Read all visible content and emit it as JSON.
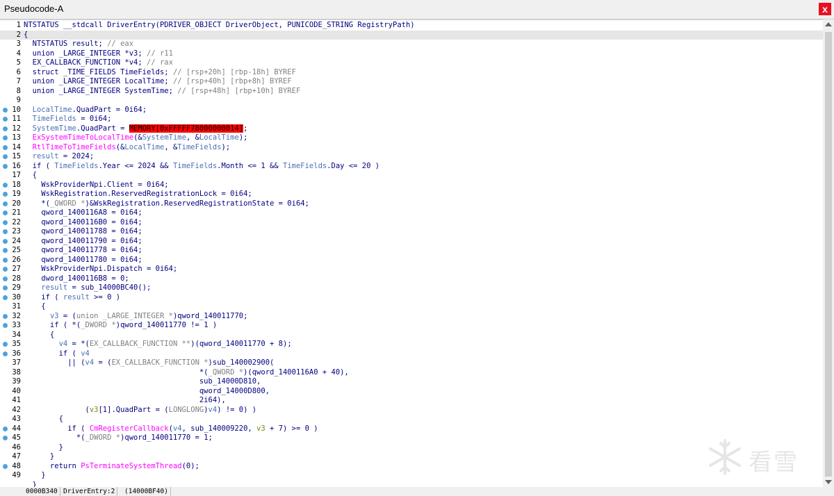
{
  "tab": {
    "title": "Pseudocode-A",
    "close_glyph": "x"
  },
  "colors": {
    "background": "#ffffff",
    "current_line": "#e6e6e6",
    "highlight": "#ff0000",
    "breakpoint": "#4aa3df"
  },
  "code_lines": [
    {
      "n": "1",
      "dot": false,
      "current": false,
      "parts": [
        [
          "k",
          "NTSTATUS __stdcall DriverEntry(PDRIVER_OBJECT DriverObject, PUNICODE_STRING RegistryPath)"
        ]
      ]
    },
    {
      "n": "2",
      "dot": false,
      "current": true,
      "parts": [
        [
          "k",
          "{"
        ]
      ]
    },
    {
      "n": "3",
      "dot": false,
      "current": false,
      "parts": [
        [
          "k",
          "  NTSTATUS result; "
        ],
        [
          "g",
          "// eax"
        ]
      ]
    },
    {
      "n": "4",
      "dot": false,
      "current": false,
      "parts": [
        [
          "k",
          "  union _LARGE_INTEGER *v3; "
        ],
        [
          "g",
          "// r11"
        ]
      ]
    },
    {
      "n": "5",
      "dot": false,
      "current": false,
      "parts": [
        [
          "k",
          "  EX_CALLBACK_FUNCTION *v4; "
        ],
        [
          "g",
          "// rax"
        ]
      ]
    },
    {
      "n": "6",
      "dot": false,
      "current": false,
      "parts": [
        [
          "k",
          "  struct _TIME_FIELDS TimeFields; "
        ],
        [
          "g",
          "// [rsp+20h] [rbp-18h] BYREF"
        ]
      ]
    },
    {
      "n": "7",
      "dot": false,
      "current": false,
      "parts": [
        [
          "k",
          "  union _LARGE_INTEGER LocalTime; "
        ],
        [
          "g",
          "// [rsp+40h] [rbp+8h] BYREF"
        ]
      ]
    },
    {
      "n": "8",
      "dot": false,
      "current": false,
      "parts": [
        [
          "k",
          "  union _LARGE_INTEGER SystemTime; "
        ],
        [
          "g",
          "// [rsp+48h] [rbp+10h] BYREF"
        ]
      ]
    },
    {
      "n": "9",
      "dot": false,
      "current": false,
      "parts": [
        [
          "k",
          ""
        ]
      ]
    },
    {
      "n": "10",
      "dot": true,
      "current": false,
      "parts": [
        [
          "k",
          "  "
        ],
        [
          "v",
          "LocalTime"
        ],
        [
          "k",
          ".QuadPart = 0i64;"
        ]
      ]
    },
    {
      "n": "11",
      "dot": true,
      "current": false,
      "parts": [
        [
          "k",
          "  "
        ],
        [
          "v",
          "TimeFields"
        ],
        [
          "k",
          " = 0i64;"
        ]
      ]
    },
    {
      "n": "12",
      "dot": true,
      "current": false,
      "parts": [
        [
          "k",
          "  "
        ],
        [
          "v",
          "SystemTime"
        ],
        [
          "k",
          ".QuadPart = "
        ],
        [
          "h",
          "MEMORY[0xFFFFF78000000014]"
        ],
        [
          "k",
          ";"
        ]
      ]
    },
    {
      "n": "13",
      "dot": true,
      "current": false,
      "parts": [
        [
          "k",
          "  "
        ],
        [
          "p",
          "ExSystemTimeToLocalTime"
        ],
        [
          "k",
          "(&"
        ],
        [
          "v",
          "SystemTime"
        ],
        [
          "k",
          ", &"
        ],
        [
          "v",
          "LocalTime"
        ],
        [
          "k",
          ");"
        ]
      ]
    },
    {
      "n": "14",
      "dot": true,
      "current": false,
      "parts": [
        [
          "k",
          "  "
        ],
        [
          "p",
          "RtlTimeToTimeFields"
        ],
        [
          "k",
          "(&"
        ],
        [
          "v",
          "LocalTime"
        ],
        [
          "k",
          ", &"
        ],
        [
          "v",
          "TimeFields"
        ],
        [
          "k",
          ");"
        ]
      ]
    },
    {
      "n": "15",
      "dot": true,
      "current": false,
      "parts": [
        [
          "k",
          "  "
        ],
        [
          "v",
          "result"
        ],
        [
          "k",
          " = 2024;"
        ]
      ]
    },
    {
      "n": "16",
      "dot": true,
      "current": false,
      "parts": [
        [
          "k",
          "  if ( "
        ],
        [
          "v",
          "TimeFields"
        ],
        [
          "k",
          ".Year <= 2024 && "
        ],
        [
          "v",
          "TimeFields"
        ],
        [
          "k",
          ".Month <= 1 && "
        ],
        [
          "v",
          "TimeFields"
        ],
        [
          "k",
          ".Day <= 20 )"
        ]
      ]
    },
    {
      "n": "17",
      "dot": false,
      "current": false,
      "parts": [
        [
          "k",
          "  {"
        ]
      ]
    },
    {
      "n": "18",
      "dot": true,
      "current": false,
      "parts": [
        [
          "k",
          "    WskProviderNpi.Client = 0i64;"
        ]
      ]
    },
    {
      "n": "19",
      "dot": true,
      "current": false,
      "parts": [
        [
          "k",
          "    WskRegistration.ReservedRegistrationLock = 0i64;"
        ]
      ]
    },
    {
      "n": "20",
      "dot": true,
      "current": false,
      "parts": [
        [
          "k",
          "    *("
        ],
        [
          "g",
          "_QWORD *"
        ],
        [
          "k",
          ")&WskRegistration.ReservedRegistrationState = 0i64;"
        ]
      ]
    },
    {
      "n": "21",
      "dot": true,
      "current": false,
      "parts": [
        [
          "k",
          "    qword_1400116A8 = 0i64;"
        ]
      ]
    },
    {
      "n": "22",
      "dot": true,
      "current": false,
      "parts": [
        [
          "k",
          "    qword_1400116B0 = 0i64;"
        ]
      ]
    },
    {
      "n": "23",
      "dot": true,
      "current": false,
      "parts": [
        [
          "k",
          "    qword_140011788 = 0i64;"
        ]
      ]
    },
    {
      "n": "24",
      "dot": true,
      "current": false,
      "parts": [
        [
          "k",
          "    qword_140011790 = 0i64;"
        ]
      ]
    },
    {
      "n": "25",
      "dot": true,
      "current": false,
      "parts": [
        [
          "k",
          "    qword_140011778 = 0i64;"
        ]
      ]
    },
    {
      "n": "26",
      "dot": true,
      "current": false,
      "parts": [
        [
          "k",
          "    qword_140011780 = 0i64;"
        ]
      ]
    },
    {
      "n": "27",
      "dot": true,
      "current": false,
      "parts": [
        [
          "k",
          "    WskProviderNpi.Dispatch = 0i64;"
        ]
      ]
    },
    {
      "n": "28",
      "dot": true,
      "current": false,
      "parts": [
        [
          "k",
          "    dword_1400116B8 = 0;"
        ]
      ]
    },
    {
      "n": "29",
      "dot": true,
      "current": false,
      "parts": [
        [
          "k",
          "    "
        ],
        [
          "v",
          "result"
        ],
        [
          "k",
          " = sub_14000BC40();"
        ]
      ]
    },
    {
      "n": "30",
      "dot": true,
      "current": false,
      "parts": [
        [
          "k",
          "    if ( "
        ],
        [
          "v",
          "result"
        ],
        [
          "k",
          " >= 0 )"
        ]
      ]
    },
    {
      "n": "31",
      "dot": false,
      "current": false,
      "parts": [
        [
          "k",
          "    {"
        ]
      ]
    },
    {
      "n": "32",
      "dot": true,
      "current": false,
      "parts": [
        [
          "k",
          "      "
        ],
        [
          "v",
          "v3"
        ],
        [
          "k",
          " = ("
        ],
        [
          "g",
          "union _LARGE_INTEGER *"
        ],
        [
          "k",
          ")qword_140011770;"
        ]
      ]
    },
    {
      "n": "33",
      "dot": true,
      "current": false,
      "parts": [
        [
          "k",
          "      if ( *("
        ],
        [
          "g",
          "_DWORD *"
        ],
        [
          "k",
          ")qword_140011770 != 1 )"
        ]
      ]
    },
    {
      "n": "34",
      "dot": false,
      "current": false,
      "parts": [
        [
          "k",
          "      {"
        ]
      ]
    },
    {
      "n": "35",
      "dot": true,
      "current": false,
      "parts": [
        [
          "k",
          "        "
        ],
        [
          "v",
          "v4"
        ],
        [
          "k",
          " = *("
        ],
        [
          "g",
          "EX_CALLBACK_FUNCTION **"
        ],
        [
          "k",
          ")(qword_140011770 + 8);"
        ]
      ]
    },
    {
      "n": "36",
      "dot": true,
      "current": false,
      "parts": [
        [
          "k",
          "        if ( "
        ],
        [
          "v",
          "v4"
        ]
      ]
    },
    {
      "n": "37",
      "dot": false,
      "current": false,
      "parts": [
        [
          "k",
          "          || ("
        ],
        [
          "v",
          "v4"
        ],
        [
          "k",
          " = ("
        ],
        [
          "g",
          "EX_CALLBACK_FUNCTION *"
        ],
        [
          "k",
          ")sub_140002900("
        ]
      ]
    },
    {
      "n": "38",
      "dot": false,
      "current": false,
      "parts": [
        [
          "k",
          "                                        *("
        ],
        [
          "g",
          "_QWORD *"
        ],
        [
          "k",
          ")(qword_1400116A0 + 40),"
        ]
      ]
    },
    {
      "n": "39",
      "dot": false,
      "current": false,
      "parts": [
        [
          "k",
          "                                        sub_14000D810,"
        ]
      ]
    },
    {
      "n": "40",
      "dot": false,
      "current": false,
      "parts": [
        [
          "k",
          "                                        qword_14000D800,"
        ]
      ]
    },
    {
      "n": "41",
      "dot": false,
      "current": false,
      "parts": [
        [
          "k",
          "                                        2i64),"
        ]
      ]
    },
    {
      "n": "42",
      "dot": false,
      "current": false,
      "parts": [
        [
          "k",
          "              ("
        ],
        [
          "o",
          "v3"
        ],
        [
          "k",
          "[1].QuadPart = ("
        ],
        [
          "g",
          "LONGLONG"
        ],
        [
          "k",
          ")"
        ],
        [
          "v",
          "v4"
        ],
        [
          "k",
          ") != 0) )"
        ]
      ]
    },
    {
      "n": "43",
      "dot": false,
      "current": false,
      "parts": [
        [
          "k",
          "        {"
        ]
      ]
    },
    {
      "n": "44",
      "dot": true,
      "current": false,
      "parts": [
        [
          "k",
          "          if ( "
        ],
        [
          "p",
          "CmRegisterCallback"
        ],
        [
          "k",
          "("
        ],
        [
          "v",
          "v4"
        ],
        [
          "k",
          ", sub_140009220, "
        ],
        [
          "o",
          "v3"
        ],
        [
          "k",
          " + 7) >= 0 )"
        ]
      ]
    },
    {
      "n": "45",
      "dot": true,
      "current": false,
      "parts": [
        [
          "k",
          "            *("
        ],
        [
          "g",
          "_DWORD *"
        ],
        [
          "k",
          ")qword_140011770 = 1;"
        ]
      ]
    },
    {
      "n": "46",
      "dot": false,
      "current": false,
      "parts": [
        [
          "k",
          "        }"
        ]
      ]
    },
    {
      "n": "47",
      "dot": false,
      "current": false,
      "parts": [
        [
          "k",
          "      }"
        ]
      ]
    },
    {
      "n": "48",
      "dot": true,
      "current": false,
      "parts": [
        [
          "k",
          "      return "
        ],
        [
          "p",
          "PsTerminateSystemThread"
        ],
        [
          "k",
          "(0);"
        ]
      ]
    },
    {
      "n": "49",
      "dot": false,
      "current": false,
      "parts": [
        [
          "k",
          "    }"
        ]
      ]
    },
    {
      "n": "",
      "dot": false,
      "current": false,
      "parts": [
        [
          "k",
          "  }"
        ]
      ]
    }
  ],
  "status": {
    "offset": "0000B340",
    "location": "DriverEntry:2",
    "address": "(14000BF40)"
  },
  "watermark": {
    "text": "看雪"
  }
}
